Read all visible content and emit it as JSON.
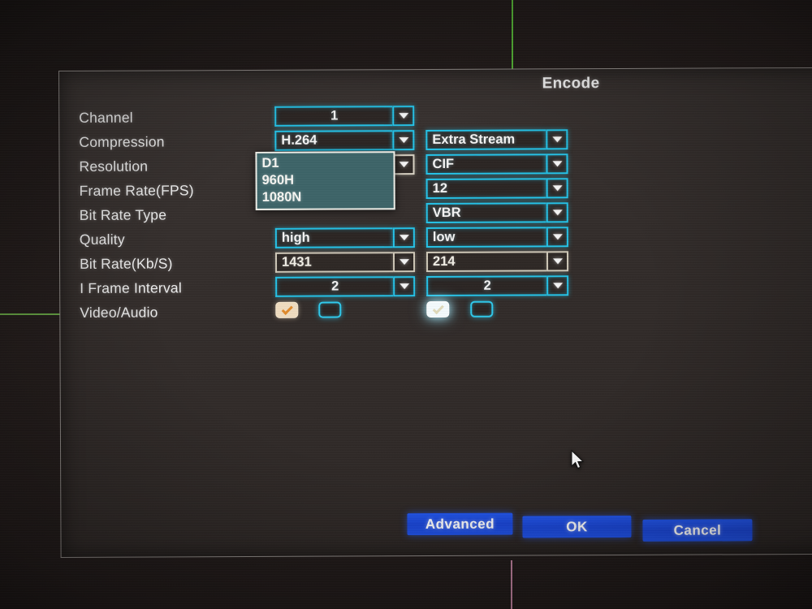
{
  "window": {
    "title": "Encode",
    "cursor_icon": "arrow-pointer-icon"
  },
  "colors": {
    "accent_cyan": "#25c3e8",
    "focus_yellow": "#d6f05a",
    "button_blue": "#2257f0",
    "dropdown_teal": "#3d6468",
    "dialog_bg": "#3a3432",
    "check_cream": "#f0dcc0",
    "check_mark_orange": "#e08a2c",
    "grid_line_green": "#5bc43a",
    "grid_line_pink": "#d58fb0"
  },
  "form": {
    "rows": [
      {
        "label": "Channel",
        "main": "1",
        "extra": null,
        "main_style": "normal",
        "extra_style": "normal",
        "main_align": "center",
        "extra_align": "left"
      },
      {
        "label": "Compression",
        "main": "H.264",
        "extra": "Extra Stream",
        "main_style": "normal",
        "extra_style": "normal",
        "main_align": "left",
        "extra_align": "left"
      },
      {
        "label": "Resolution",
        "main": "1080N",
        "extra": "CIF",
        "main_style": "focused",
        "extra_style": "normal",
        "main_align": "left",
        "extra_align": "left"
      },
      {
        "label": "Frame Rate(FPS)",
        "main": "",
        "extra": "12",
        "main_style": "normal",
        "extra_style": "normal",
        "main_align": "left",
        "extra_align": "left"
      },
      {
        "label": "Bit Rate Type",
        "main": "",
        "extra": "VBR",
        "main_style": "normal",
        "extra_style": "normal",
        "main_align": "left",
        "extra_align": "left"
      },
      {
        "label": "Quality",
        "main": "high",
        "extra": "low",
        "main_style": "normal",
        "extra_style": "normal",
        "main_align": "left",
        "extra_align": "left"
      },
      {
        "label": "Bit Rate(Kb/S)",
        "main": "1431",
        "extra": "214",
        "main_style": "editable",
        "extra_style": "editable",
        "main_align": "left",
        "extra_align": "left"
      },
      {
        "label": "I Frame Interval",
        "main": "2",
        "extra": "2",
        "main_style": "normal",
        "extra_style": "normal",
        "main_align": "center",
        "extra_align": "center"
      }
    ],
    "video_audio_label": "Video/Audio",
    "checkboxes": {
      "main_video": {
        "name": "main-stream-video-checkbox",
        "checked": true,
        "state": "checked-cream"
      },
      "main_audio": {
        "name": "main-stream-audio-checkbox",
        "checked": false,
        "state": "unchecked"
      },
      "extra_video": {
        "name": "extra-stream-video-checkbox",
        "checked": true,
        "state": "checked-glow"
      },
      "extra_audio": {
        "name": "extra-stream-audio-checkbox",
        "checked": false,
        "state": "unchecked"
      }
    }
  },
  "dropdown": {
    "open": true,
    "anchor_field": "Resolution",
    "selected": "1080N",
    "options": [
      "D1",
      "960H",
      "1080N"
    ]
  },
  "footer": {
    "advanced_label": "Advanced",
    "ok_label": "OK",
    "cancel_label": "Cancel"
  }
}
